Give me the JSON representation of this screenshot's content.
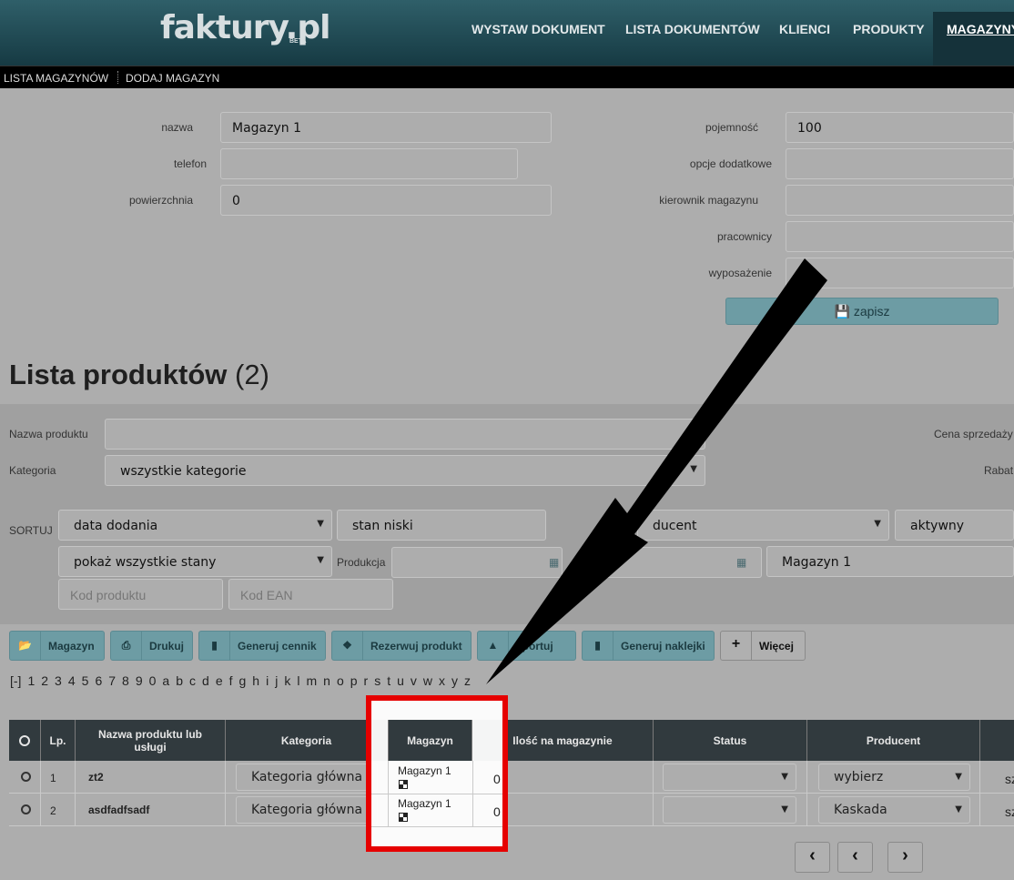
{
  "brand": {
    "logo": "faktury.pl",
    "beta": "BETA"
  },
  "nav": {
    "items": [
      "WYSTAW DOKUMENT",
      "LISTA DOKUMENTÓW",
      "KLIENCI",
      "PRODUKTY"
    ],
    "active": "MAGAZYNY"
  },
  "subnav": {
    "items": [
      "LISTA MAGAZYNÓW",
      "DODAJ MAGAZYN"
    ]
  },
  "form": {
    "left": [
      {
        "label": "nazwa",
        "value": "Magazyn 1"
      },
      {
        "label": "telefon",
        "value": ""
      },
      {
        "label": "powierzchnia",
        "value": "0"
      }
    ],
    "right": [
      {
        "label": "pojemność",
        "value": "100"
      },
      {
        "label": "opcje dodatkowe",
        "value": ""
      },
      {
        "label": "kierownik magazynu",
        "value": ""
      },
      {
        "label": "pracownicy",
        "value": ""
      },
      {
        "label": "wyposażenie",
        "value": ""
      }
    ],
    "save_label": "zapisz"
  },
  "list": {
    "title": "Lista produktów",
    "count": "(2)"
  },
  "filters": {
    "name_label": "Nazwa produktu",
    "category_label": "Kategoria",
    "category_value": "wszystkie kategorie",
    "price_label": "Cena sprzedaży",
    "rabat_label": "Rabat",
    "sort_label": "SORTUJ",
    "sort_value": "data dodania",
    "stock_value": "stan niski",
    "producer_value": "ducent",
    "active_value": "aktywny",
    "states_value": "pokaż wszystkie stany",
    "production_label": "Produkcja",
    "warehouse_value": "Magazyn 1",
    "code_placeholder": "Kod produktu",
    "ean_placeholder": "Kod EAN"
  },
  "toolbar": [
    "Magazyn",
    "Drukuj",
    "Generuj cennik",
    "Rezerwuj produkt",
    "sportuj",
    "Generuj naklejki",
    "Więcej"
  ],
  "letters": [
    "[-]",
    "1",
    "2",
    "3",
    "4",
    "5",
    "6",
    "7",
    "8",
    "9",
    "0",
    "a",
    "b",
    "c",
    "d",
    "e",
    "f",
    "g",
    "h",
    "i",
    "j",
    "k",
    "l",
    "m",
    "n",
    "o",
    "p",
    "r",
    "s",
    "t",
    "u",
    "v",
    "w",
    "x",
    "y",
    "z"
  ],
  "table": {
    "headers": {
      "lp": "Lp.",
      "name": "Nazwa produktu lub usługi",
      "category": "Kategoria",
      "warehouse": "Magazyn",
      "qty": "Ilość na magazynie",
      "status": "Status",
      "producer": "Producent"
    },
    "rows": [
      {
        "lp": "1",
        "name": "zt2",
        "category": "Kategoria główna",
        "warehouse": "Magazyn 1",
        "qty": "0",
        "status": "",
        "producer": "wybierz",
        "extra": "sz"
      },
      {
        "lp": "2",
        "name": "asdfadfsadf",
        "category": "Kategoria główna",
        "warehouse": "Magazyn 1",
        "qty": "0",
        "status": "",
        "producer": "Kaskada",
        "extra": "sz"
      }
    ]
  },
  "pager": [
    "‹",
    "‹",
    "›"
  ],
  "colors": {
    "accent": "#6d9ca4",
    "header": "#313a3e",
    "highlight": "#e60000"
  }
}
